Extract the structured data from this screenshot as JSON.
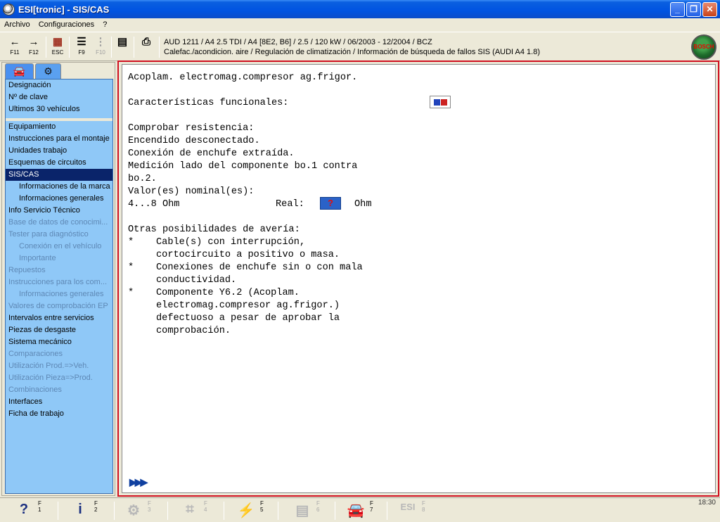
{
  "window": {
    "title": "ESI[tronic] - SIS/CAS",
    "minimize_glyph": "_",
    "maximize_glyph": "❐",
    "close_glyph": "✕"
  },
  "menu": [
    "Archivo",
    "Configuraciones",
    "?"
  ],
  "toolbar": {
    "buttons": [
      {
        "key": "F11",
        "icon": "arrow-left-icon",
        "glyph": "←"
      },
      {
        "key": "F12",
        "icon": "arrow-right-icon",
        "glyph": "→"
      },
      {
        "key": "ESC",
        "icon": "exit-icon",
        "glyph": "▦"
      },
      {
        "key": "F9",
        "icon": "list-icon",
        "glyph": "☰"
      },
      {
        "key": "F10",
        "icon": "tree-icon",
        "glyph": "⋮"
      },
      {
        "key": "",
        "icon": "document-icon",
        "glyph": "▤"
      },
      {
        "key": "",
        "icon": "printer-icon",
        "glyph": "⎙"
      }
    ],
    "vehicle_line1": "AUD 1211 / A4 2.5 TDI / A4 [8E2, B6] / 2.5 / 120 kW / 06/2003 - 12/2004 / BCZ",
    "vehicle_line2": "Calefac./acondicion. aire / Regulación de climatización  / Información de búsqueda de fallos SIS (AUDI A4 1.8)",
    "logo_text": "BOSCH"
  },
  "sidebar": {
    "tabs": [
      {
        "icon": "car-icon",
        "glyph": "🚘"
      },
      {
        "icon": "engine-icon",
        "glyph": "⚙"
      }
    ],
    "group1": [
      "Designación",
      "Nº de clave",
      "Ultimos 30 vehículos"
    ],
    "group2": [
      {
        "label": "Equipamiento",
        "sub": false,
        "disabled": false,
        "selected": false
      },
      {
        "label": "Instrucciones para el montaje",
        "sub": false,
        "disabled": false,
        "selected": false
      },
      {
        "label": "Unidades trabajo",
        "sub": false,
        "disabled": false,
        "selected": false
      },
      {
        "label": "Esquemas de circuitos",
        "sub": false,
        "disabled": false,
        "selected": false
      },
      {
        "label": "SIS/CAS",
        "sub": false,
        "disabled": false,
        "selected": true
      },
      {
        "label": "Informaciones de la marca",
        "sub": true,
        "disabled": false,
        "selected": false
      },
      {
        "label": "Informaciones generales",
        "sub": true,
        "disabled": false,
        "selected": false
      },
      {
        "label": "Info Servicio Técnico",
        "sub": false,
        "disabled": false,
        "selected": false
      },
      {
        "label": "Base de datos de conocimi...",
        "sub": false,
        "disabled": true,
        "selected": false
      },
      {
        "label": "Tester para diagnóstico",
        "sub": false,
        "disabled": true,
        "selected": false
      },
      {
        "label": "Conexión en el vehículo",
        "sub": true,
        "disabled": true,
        "selected": false
      },
      {
        "label": "Importante",
        "sub": true,
        "disabled": true,
        "selected": false
      },
      {
        "label": "Repuestos",
        "sub": false,
        "disabled": true,
        "selected": false
      },
      {
        "label": "Instrucciones para los com...",
        "sub": false,
        "disabled": true,
        "selected": false
      },
      {
        "label": "Informaciones generales",
        "sub": true,
        "disabled": true,
        "selected": false
      },
      {
        "label": "Valores de comprobación EP",
        "sub": false,
        "disabled": true,
        "selected": false
      },
      {
        "label": "Intervalos entre servicios",
        "sub": false,
        "disabled": false,
        "selected": false
      },
      {
        "label": "Piezas de desgaste",
        "sub": false,
        "disabled": false,
        "selected": false
      },
      {
        "label": "Sistema mecánico",
        "sub": false,
        "disabled": false,
        "selected": false
      },
      {
        "label": "Comparaciones",
        "sub": false,
        "disabled": true,
        "selected": false
      },
      {
        "label": "Utilización Prod.=>Veh.",
        "sub": false,
        "disabled": true,
        "selected": false
      },
      {
        "label": "Utilización Pieza=>Prod.",
        "sub": false,
        "disabled": true,
        "selected": false
      },
      {
        "label": "Combinaciones",
        "sub": false,
        "disabled": true,
        "selected": false
      },
      {
        "label": "Interfaces",
        "sub": false,
        "disabled": false,
        "selected": false
      },
      {
        "label": "Ficha de trabajo",
        "sub": false,
        "disabled": false,
        "selected": false
      }
    ]
  },
  "document": {
    "title": "Acoplam. electromag.compresor ag.frigor.",
    "functional": "Características funcionales:",
    "check": "Comprobar resistencia:",
    "ignition": "Encendido desconectado.",
    "plug": "Conexión de enchufe extraída.",
    "measure1": "Medición lado del componente bo.1 contra",
    "measure2": "bo.2.",
    "nominal": "Valor(es) nominal(es):",
    "range": "4...8 Ohm",
    "real_label": "Real:",
    "real_value": "?",
    "real_unit": "Ohm",
    "other": "Otras posibilidades de avería:",
    "bullets": [
      [
        "Cable(s) con interrupción,",
        "cortocircuito a positivo o masa."
      ],
      [
        "Conexiones de enchufe sin o con mala",
        "conductividad."
      ],
      [
        "Componente Y6.2 (Acoplam.",
        "electromag.compresor ag.frigor.)",
        "defectuoso a pesar de aprobar la",
        "comprobación."
      ]
    ],
    "bullet_char": "*",
    "next_glyph": "▶▶▶"
  },
  "function_bar": {
    "keys": [
      {
        "key": "F\n1",
        "icon": "help-icon",
        "glyph": "?",
        "disabled": false
      },
      {
        "key": "F\n2",
        "icon": "info-icon",
        "glyph": "i",
        "disabled": false
      },
      {
        "key": "F\n3",
        "icon": "components-icon",
        "glyph": "⚙",
        "disabled": true
      },
      {
        "key": "F\n4",
        "icon": "circuit-icon",
        "glyph": "⌗",
        "disabled": true
      },
      {
        "key": "F\n5",
        "icon": "diagnosis-icon",
        "glyph": "⚡",
        "disabled": false
      },
      {
        "key": "F\n6",
        "icon": "sheet-icon",
        "glyph": "▤",
        "disabled": true
      },
      {
        "key": "F\n7",
        "icon": "vehicle-icon",
        "glyph": "🚘",
        "disabled": false
      },
      {
        "key": "F\n8",
        "icon": "esi-icon",
        "glyph": "ESI",
        "disabled": true
      }
    ],
    "clock": "18:30"
  },
  "colors": {
    "nav_bg": "#8fc8f7",
    "selected_bg": "#0a246a",
    "frame_red": "#d01020"
  }
}
